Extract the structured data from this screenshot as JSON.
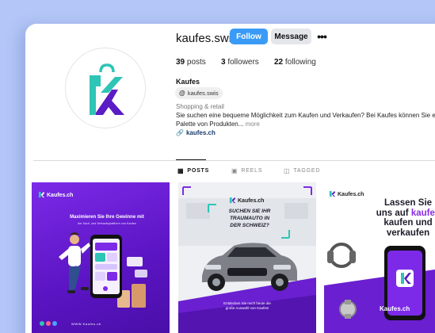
{
  "profile": {
    "username": "kaufes.swis",
    "follow_label": "Follow",
    "message_label": "Message",
    "more_label": "•••",
    "stats": {
      "posts_count": "39",
      "posts_label": "posts",
      "followers_count": "3",
      "followers_label": "followers",
      "following_count": "22",
      "following_label": "following"
    },
    "name": "Kaufes",
    "threads_handle": "kaufes.swis",
    "category": "Shopping & retail",
    "bio_line1": "Sie suchen eine bequeme Möglichkeit zum Kaufen und Verkaufen? Bei Kaufes können Sie ein",
    "bio_line2": "Palette von Produkten...",
    "bio_more": "more",
    "link": "kaufes.ch"
  },
  "tabs": [
    {
      "label": "POSTS",
      "icon": "grid-icon",
      "active": true
    },
    {
      "label": "REELS",
      "icon": "reels-icon",
      "active": false
    },
    {
      "label": "TAGGED",
      "icon": "tagged-icon",
      "active": false
    }
  ],
  "posts": [
    {
      "logo": "Kaufes.ch",
      "headline": "Maximieren Sie Ihre Gewinne mit",
      "sub": "der Kauf- und Verkaufsplattform von Kaufes",
      "footer": "WWW.Kaufes.ch"
    },
    {
      "logo": "Kaufes.ch",
      "banner_line1": "SUCHEN SIE IHR",
      "banner_line2": "TRAUMAUTO IN",
      "banner_line3": "DER SCHWEIZ?",
      "cta_line1": "Entdecken Sie noch heute die",
      "cta_line2": "große Auswahl von Kaufes!"
    },
    {
      "logo": "Kaufes.ch",
      "heading_line1": "Lassen Sie",
      "heading_line2a": "uns auf ",
      "heading_line2b": "kaufes",
      "heading_line3": "kaufen und",
      "heading_line4": "verkaufen",
      "brand": "Kaufes.ch"
    }
  ],
  "colors": {
    "background": "#b3c6f7",
    "follow_button": "#3a9bf7",
    "brand_purple": "#7c2ae8",
    "brand_teal": "#2ec4b6"
  }
}
